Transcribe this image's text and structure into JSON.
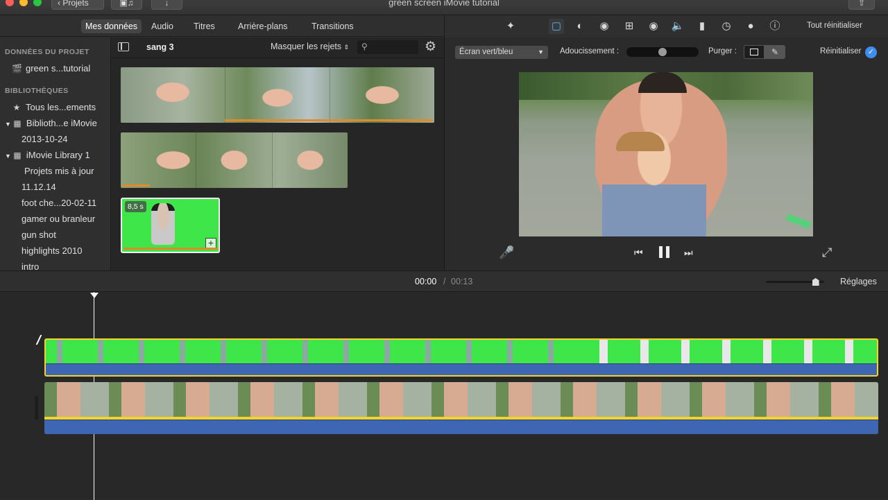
{
  "window": {
    "title": "green screen iMovie tutorial",
    "back_label": "Projets"
  },
  "browser_tabs": [
    "Mes données",
    "Audio",
    "Titres",
    "Arrière-plans",
    "Transitions"
  ],
  "sidebar": {
    "project_header": "DONNÉES DU PROJET",
    "project_item": "green s...tutorial",
    "libraries_header": "BIBLIOTHÈQUES",
    "items": [
      {
        "label": "Tous les...ements",
        "icon": "star-icon"
      },
      {
        "label": "Biblioth...e iMovie",
        "icon": "grid-icon"
      },
      {
        "label": "2013-10-24"
      },
      {
        "label": "iMovie Library 1",
        "icon": "grid-icon"
      },
      {
        "label": "Projets mis à jour"
      },
      {
        "label": "11.12.14"
      },
      {
        "label": "foot che...20-02-11"
      },
      {
        "label": "gamer ou branleur"
      },
      {
        "label": "gun shot"
      },
      {
        "label": "highlights 2010"
      },
      {
        "label": "intro"
      }
    ]
  },
  "browser": {
    "event_name": "sang 3",
    "filter_label": "Masquer les rejets",
    "search_placeholder": "",
    "clip_duration_badge": "8,5 s"
  },
  "viewer": {
    "reset_all_label": "Tout réinitialiser",
    "effect_select": "Écran vert/bleu",
    "softness_label": "Adoucissement :",
    "softness_level": 0.5,
    "purge_label": "Purger :",
    "reset_label": "Réinitialiser"
  },
  "timeline": {
    "current_time": "00:00",
    "separator": "/",
    "total_time": "00:13",
    "settings_label": "Réglages",
    "zoom_level": 0.9
  },
  "colors": {
    "green_screen": "#3ee64a",
    "audio_wave": "#3f66b3",
    "selection_yellow": "#f2d42b",
    "accent_blue": "#3d8ef0"
  }
}
